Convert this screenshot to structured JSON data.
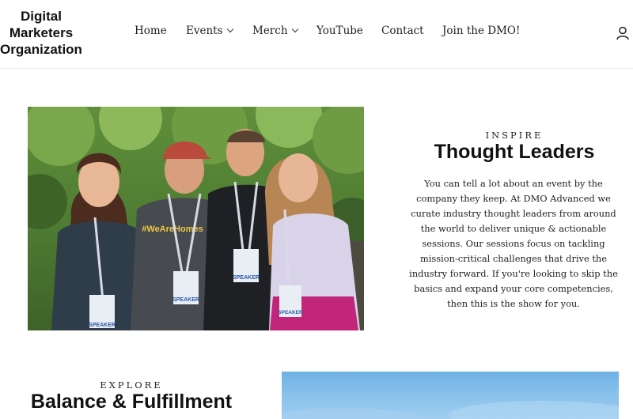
{
  "brand": {
    "line1": "Digital",
    "line2": "Marketers",
    "line3": "Organization"
  },
  "nav": {
    "home": "Home",
    "events": "Events",
    "merch": "Merch",
    "youtube": "YouTube",
    "contact": "Contact",
    "join": "Join the DMO!"
  },
  "header": {
    "account_icon": "user-icon"
  },
  "section1": {
    "eyebrow": "INSPIRE",
    "title": "Thought Leaders",
    "body": "You can tell a lot about an event by the company they keep. At DMO Advanced we curate industry thought leaders from around the world to deliver unique & actionable sessions. Our sessions focus on tackling mission-critical challenges that drive the industry forward. If you're looking to skip the basics and expand your core competencies, then this is the show for you.",
    "photo_badge_text": "SPEAKER",
    "photo_shirt_text": "#WeAreHomes"
  },
  "section2": {
    "eyebrow": "EXPLORE",
    "title": "Balance & Fulfillment"
  },
  "colors": {
    "text": "#111111",
    "border": "#ececec",
    "sky": "#86c0eb"
  }
}
